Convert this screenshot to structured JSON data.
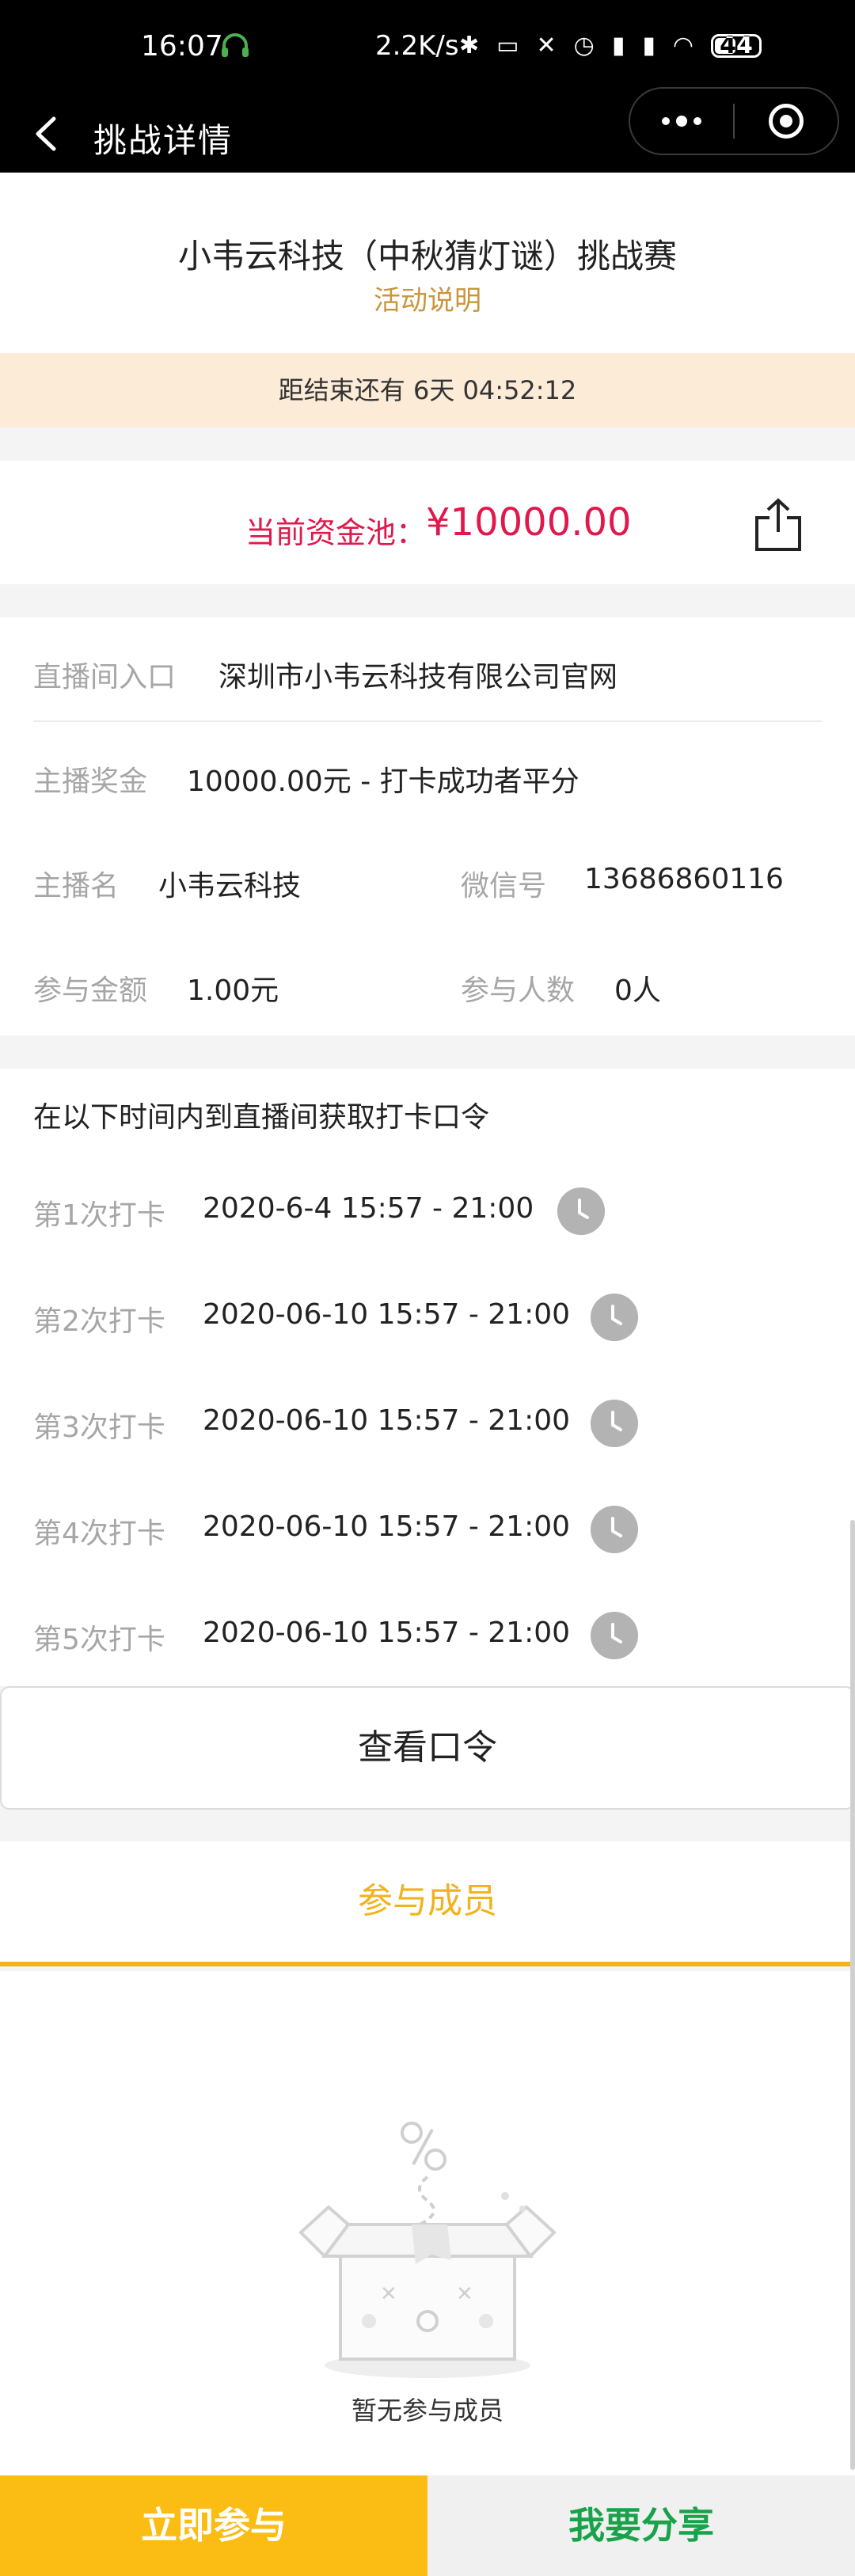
{
  "status_bar": {
    "time": "16:07",
    "network_speed": "2.2K/s",
    "battery": "44"
  },
  "nav": {
    "title": "挑战详情"
  },
  "header": {
    "title": "小韦云科技（中秋猜灯谜）挑战赛",
    "link": "活动说明"
  },
  "countdown": "距结束还有 6天 04:52:12",
  "pool": {
    "label": "当前资金池：",
    "value": "¥10000.00"
  },
  "info": {
    "live_entry_label": "直播间入口",
    "live_entry_value": "深圳市小韦云科技有限公司官网",
    "reward_label": "主播奖金",
    "reward_value": "10000.00元 - 打卡成功者平分",
    "anchor_label": "主播名",
    "anchor_value": "小韦云科技",
    "wechat_label": "微信号",
    "wechat_value": "13686860116",
    "fee_label": "参与金额",
    "fee_value": "1.00元",
    "participants_label": "参与人数",
    "participants_value": "0人"
  },
  "checkins": {
    "title": "在以下时间内到直播间获取打卡口令",
    "items": [
      {
        "label": "第1次打卡",
        "time": "2020-6-4 15:57 - 21:00"
      },
      {
        "label": "第2次打卡",
        "time": "2020-06-10 15:57 - 21:00"
      },
      {
        "label": "第3次打卡",
        "time": "2020-06-10 15:57 - 21:00"
      },
      {
        "label": "第4次打卡",
        "time": "2020-06-10 15:57 - 21:00"
      },
      {
        "label": "第5次打卡",
        "time": "2020-06-10 15:57 - 21:00"
      }
    ]
  },
  "view_password_button": "查看口令",
  "members_tab": "参与成员",
  "empty_text": "暂无参与成员",
  "footer": {
    "join": "立即参与",
    "share": "我要分享"
  },
  "colors": {
    "accent_gold": "#c9963c",
    "pool_red": "#e0184b",
    "tab_yellow": "#f2b21b",
    "join_bg": "#fbbd14",
    "share_green": "#18a34a"
  },
  "icons": [
    "headset-icon",
    "bluetooth-icon",
    "mute-icon",
    "alarm-icon",
    "signal-icon",
    "wifi-icon",
    "battery-icon",
    "back-icon",
    "more-icon",
    "close-capsule-icon",
    "share-icon",
    "clock-icon",
    "empty-box-icon"
  ]
}
